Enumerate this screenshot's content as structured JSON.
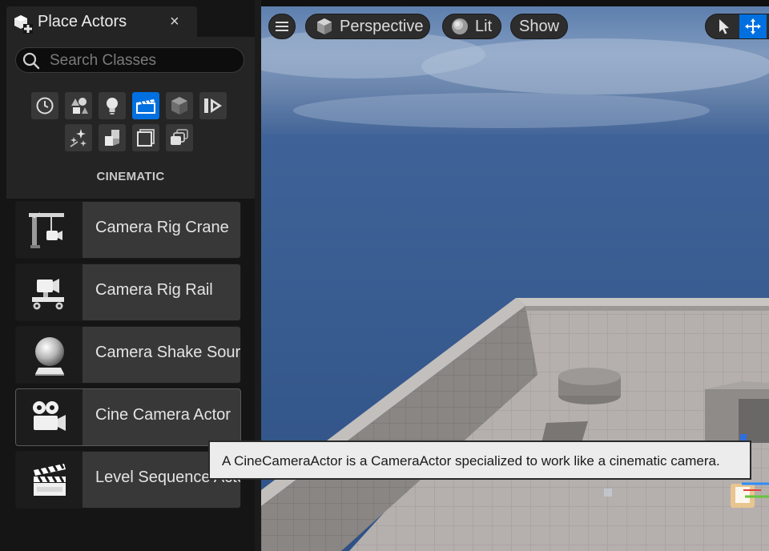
{
  "panel": {
    "title": "Place Actors",
    "close_glyph": "×",
    "search": {
      "placeholder": "Search Classes",
      "value": ""
    },
    "categories": [
      {
        "name": "recent-icon",
        "active": false
      },
      {
        "name": "basic-shapes-icon",
        "active": false
      },
      {
        "name": "lights-icon",
        "active": false
      },
      {
        "name": "cinematic-icon",
        "active": true
      },
      {
        "name": "visual-effects-cube-icon",
        "active": false
      },
      {
        "name": "media-play-icon",
        "active": false
      },
      {
        "name": "sparkles-icon",
        "active": false
      },
      {
        "name": "geometry-icon",
        "active": false
      },
      {
        "name": "volumes-icon",
        "active": false
      },
      {
        "name": "all-classes-icon",
        "active": false
      }
    ],
    "section_label": "CINEMATIC",
    "items": [
      {
        "label": "Camera Rig Crane",
        "icon": "camera-rig-crane-icon"
      },
      {
        "label": "Camera Rig Rail",
        "icon": "camera-rig-rail-icon"
      },
      {
        "label": "Camera Shake Source",
        "icon": "camera-shake-source-icon"
      },
      {
        "label": "Cine Camera Actor",
        "icon": "cine-camera-icon"
      },
      {
        "label": "Level Sequence Actor",
        "icon": "clapperboard-icon"
      }
    ]
  },
  "viewport": {
    "view_mode": "Perspective",
    "lighting": "Lit",
    "show": "Show",
    "colors": {
      "sky": "#3d5f95",
      "floor": "#b3aeab",
      "wall": "#8f8b88",
      "accent": "#0070e0"
    }
  },
  "tooltip": {
    "text": "A CineCameraActor is a CameraActor specialized to work like a cinematic camera."
  }
}
